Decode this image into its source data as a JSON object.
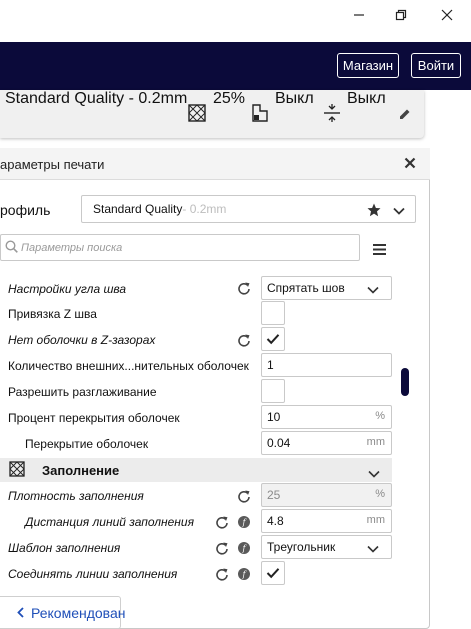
{
  "header": {
    "marketplace_label": "Магазин",
    "signin_label": "Войти"
  },
  "summary": {
    "profile": "Standard Quality - 0.2mm",
    "infill": "25%",
    "support": "Выкл",
    "adhesion": "Выкл"
  },
  "panel": {
    "title": "араметры печати",
    "profile_label": "рофиль",
    "profile_value": "Standard Quality",
    "profile_suffix": " - 0.2mm",
    "search_placeholder": "Параметры поиска"
  },
  "settings": {
    "seam_angle_label": "Настройки угла шва",
    "seam_angle_value": "Спрятать шов",
    "z_seam_label": "Привязка Z шва",
    "no_skin_label": "Нет оболочки в Z-зазорах",
    "extra_wall_label": "Количество внешних...нительных оболочек",
    "extra_wall_value": "1",
    "ironing_label": "Разрешить разглаживание",
    "overlap_pct_label": "Процент перекрытия оболочек",
    "overlap_pct_value": "10",
    "overlap_pct_unit": "%",
    "overlap_label": "Перекрытие оболочек",
    "overlap_value": "0.04",
    "overlap_unit": "mm",
    "infill_section": "Заполнение",
    "infill_density_label": "Плотность заполнения",
    "infill_density_value": "25",
    "infill_density_unit": "%",
    "line_distance_label": "Дистанция линий заполнения",
    "line_distance_value": "4.8",
    "line_distance_unit": "mm",
    "pattern_label": "Шаблон заполнения",
    "pattern_value": "Треугольник",
    "connect_lines_label": "Соединять линии заполнения"
  },
  "footer": {
    "recommended_label": "Рекомендован"
  },
  "colors": {
    "header_bg": "#0b0a3a",
    "link": "#1f4fb8"
  }
}
